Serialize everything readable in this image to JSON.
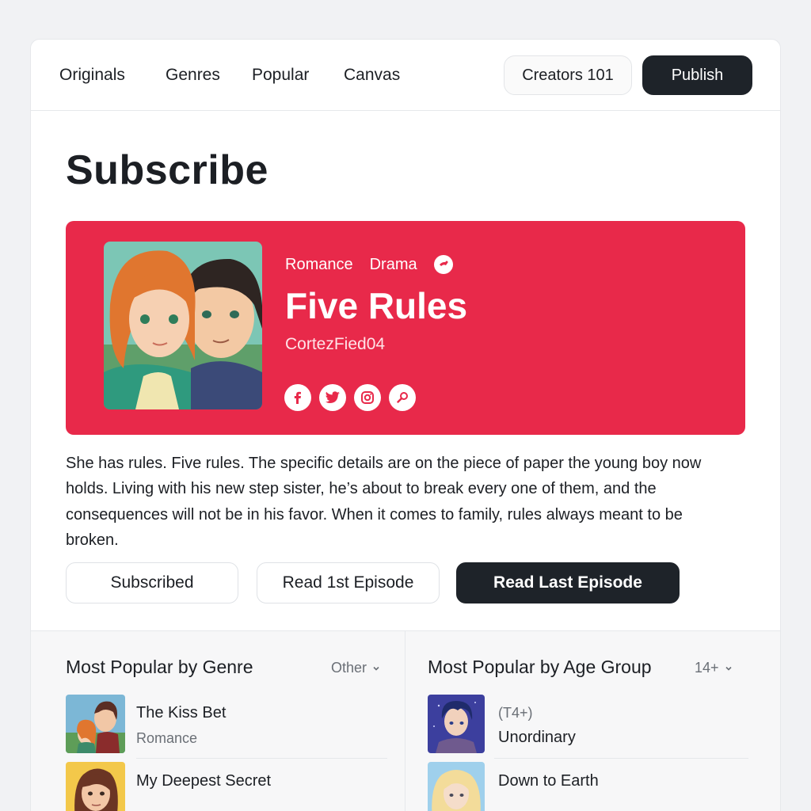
{
  "nav": {
    "links": [
      "Originals",
      "Genres",
      "Popular",
      "Canvas"
    ],
    "creators_label": "Creators 101",
    "publish_label": "Publish"
  },
  "page_title": "Subscribe",
  "hero": {
    "genres": [
      "Romance",
      "Drama"
    ],
    "title": "Five Rules",
    "author": "CortezFied04",
    "social_icons": [
      "facebook-icon",
      "twitter-icon",
      "instagram-icon",
      "link-icon"
    ],
    "accent_color": "#e8294a"
  },
  "description": "She has rules. Five rules. The specific details are on the piece of paper the young boy now holds. Living with his new step sister, he’s about to break every one of them, and the consequences will not be in his favor. When it comes to family, rules always meant to be broken.",
  "actions": {
    "subscribed_label": "Subscribed",
    "first_label": "Read 1st Episode",
    "last_label": "Read Last Episode"
  },
  "genre_panel": {
    "title": "Most Popular by Genre",
    "filter": "Other",
    "items": [
      {
        "name": "The Kiss Bet",
        "genre": "Romance"
      },
      {
        "name": "My Deepest Secret",
        "genre": ""
      }
    ]
  },
  "age_panel": {
    "title": "Most Popular by Age Group",
    "filter": "14+",
    "items": [
      {
        "rating": "(T4+)",
        "name": "Unordinary"
      },
      {
        "rating": "",
        "name": "Down to Earth"
      }
    ]
  }
}
